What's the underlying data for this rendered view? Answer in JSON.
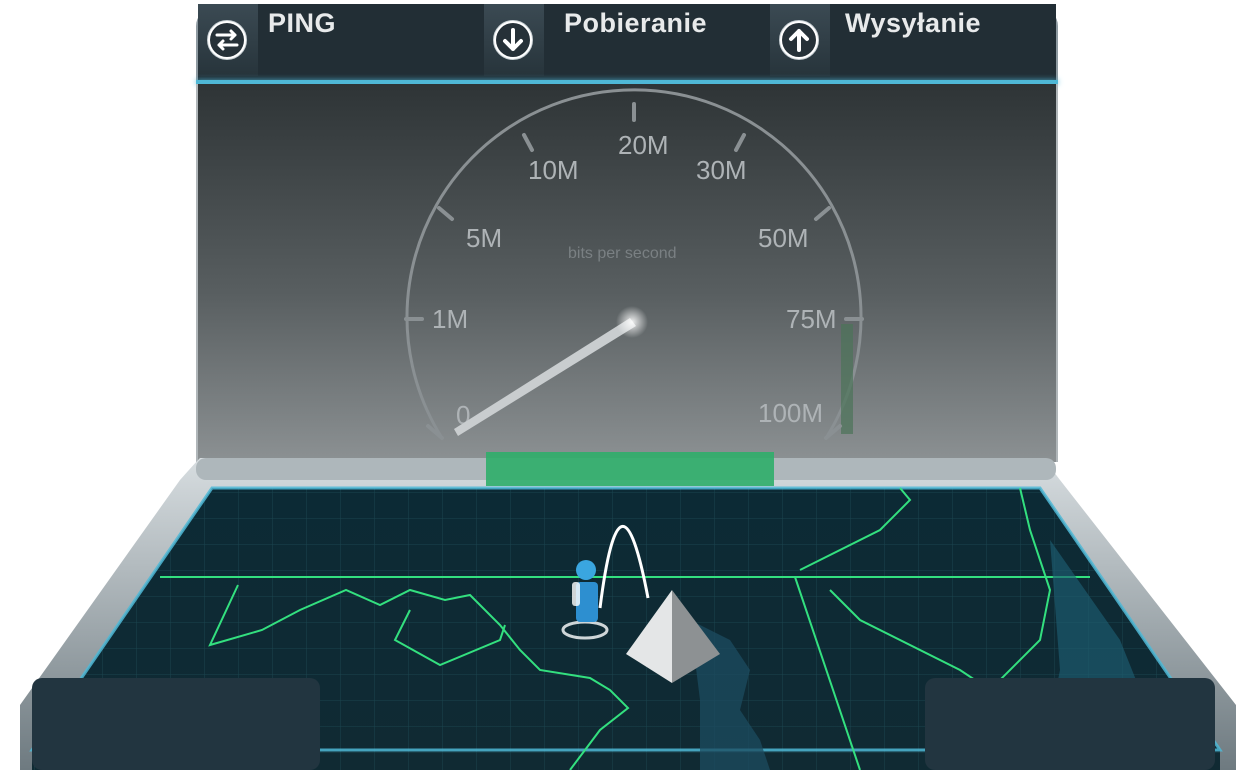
{
  "metrics": [
    {
      "label": "PING",
      "icon": "ping-arrows-icon"
    },
    {
      "label": "Pobieranie",
      "icon": "download-arrow-icon"
    },
    {
      "label": "Wysyłanie",
      "icon": "upload-arrow-icon"
    }
  ],
  "gauge": {
    "unit_label": "bits per second",
    "ticks": [
      "0",
      "1M",
      "5M",
      "10M",
      "20M",
      "30M",
      "50M",
      "75M",
      "100M"
    ],
    "needle_value": "0"
  },
  "colors": {
    "accent": "#4fb8d6",
    "map_border": "#33e07f",
    "map_bg": "#0d2630",
    "gauge_face": "#585e60"
  },
  "map": {
    "server_icon": "server-pyramid-icon",
    "user_icon": "user-figure-icon"
  }
}
